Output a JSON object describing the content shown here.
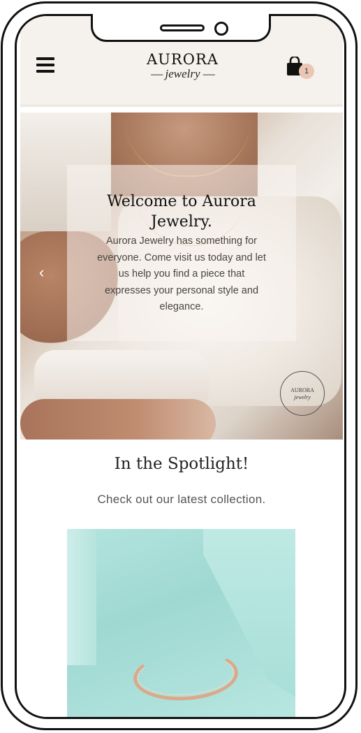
{
  "brand": {
    "name": "AURORA",
    "tagline": "jewelry",
    "dash": "—"
  },
  "header": {
    "menu_icon": "hamburger-icon",
    "cart_icon": "shopping-bag-icon",
    "cart_count": "1"
  },
  "hero": {
    "title": "Welcome to Aurora Jewelry.",
    "text": "Aurora Jewelry has something for everyone. Come visit us today and let us help you find a piece that expresses your personal style and elegance.",
    "prev_arrow": "‹",
    "next_arrow": "›",
    "stamp_brand": "AURORA",
    "stamp_sub": "jewelry"
  },
  "spotlight": {
    "title": "In the Spotlight!",
    "subtitle": "Check out our latest collection."
  },
  "colors": {
    "header_bg": "#f5f1ec",
    "badge": "#e9c7b4",
    "product_bg": "#a8dcd5"
  }
}
